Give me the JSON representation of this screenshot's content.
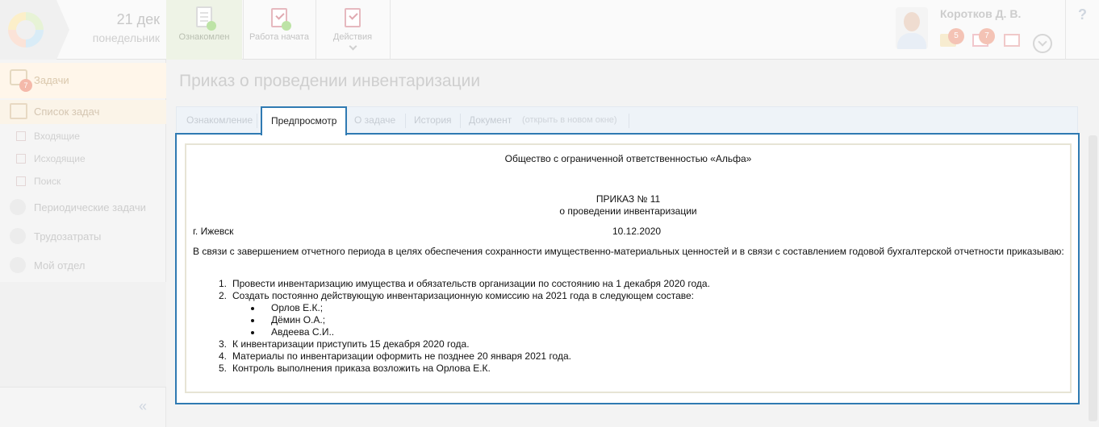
{
  "header": {
    "date_day": "21 дек",
    "date_weekday": "понедельник",
    "toolbar": {
      "acknowledged_label": "Ознакомлен",
      "work_started_label": "Работа начата",
      "actions_label": "Действия"
    },
    "user": {
      "name": "Коротков Д. В.",
      "mail_count": "5",
      "tasks_count": "7"
    },
    "help_label": "?"
  },
  "sidebar": {
    "tasks_label": "Задачи",
    "tasks_badge": "7",
    "task_list_label": "Список задач",
    "incoming_label": "Входящие",
    "outgoing_label": "Исходящие",
    "search_label": "Поиск",
    "periodic_label": "Периодические задачи",
    "effort_label": "Трудозатраты",
    "department_label": "Мой отдел",
    "collapse_label": "«"
  },
  "page": {
    "title": "Приказ о проведении инвентаризации",
    "tabs": {
      "acknowledgement": "Ознакомление",
      "preview": "Предпросмотр",
      "about": "О задаче",
      "history": "История",
      "document": "Документ",
      "open_new_window": "(открыть в новом окне)"
    }
  },
  "document": {
    "organization": "Общество с ограниченной ответственностью «Альфа»",
    "order_number": "ПРИКАЗ № 11",
    "order_subject": "о проведении инвентаризации",
    "city": "г. Ижевск",
    "date": "10.12.2020",
    "intro": "В связи с завершением отчетного периода в целях обеспечения сохранности имущественно-материальных ценностей и в связи с составлением годовой бухгалтерской отчетности приказываю:",
    "items": [
      {
        "num": "1.",
        "text": "Провести инвентаризацию имущества и обязательств организации по состоянию на 1 декабря 2020 года."
      },
      {
        "num": "2.",
        "text": "Создать постоянно действующую инвентаризационную комиссию на 2021 года в следующем составе:"
      },
      {
        "num": "3.",
        "text": "К инвентаризации приступить 15 декабря 2020 года."
      },
      {
        "num": "4.",
        "text": "Материалы по инвентаризации оформить не позднее 20 января 2021 года."
      },
      {
        "num": "5.",
        "text": "Контроль выполнения приказа возложить на Орлова Е.К."
      }
    ],
    "commission": [
      "Орлов Е.К.;",
      "Дёмин О.А.;",
      "Авдеева С.И.."
    ]
  },
  "colors": {
    "active_border": "#2f7ab2",
    "tabs_background": "#eef3f8",
    "document_border": "#e7e4d5"
  }
}
